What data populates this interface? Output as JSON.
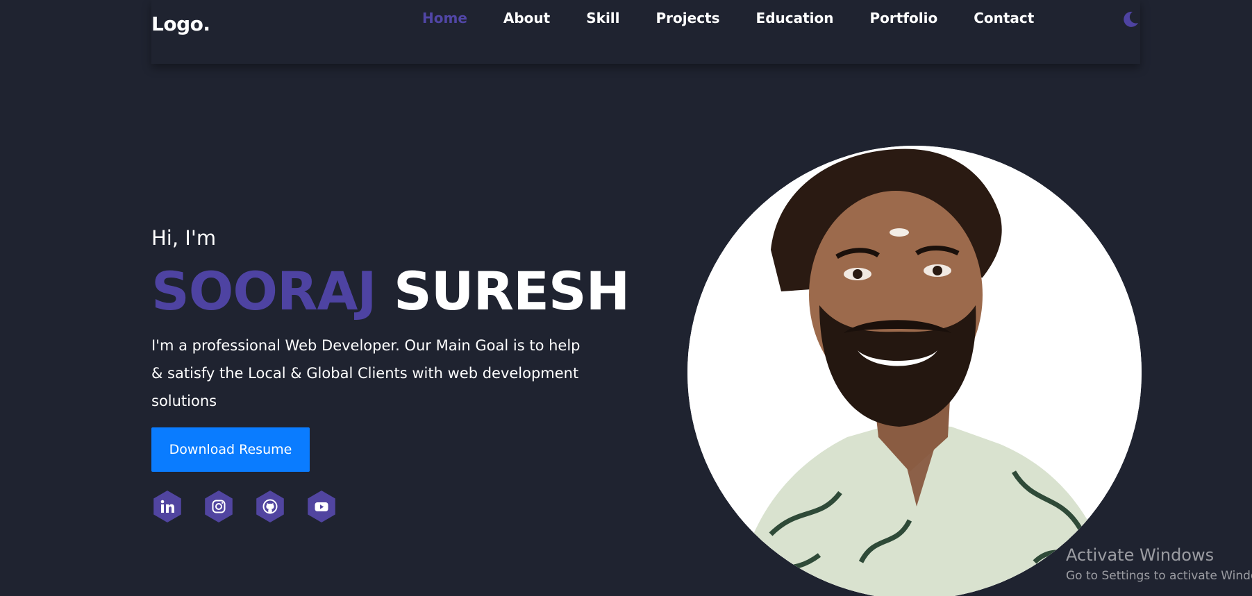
{
  "header": {
    "logo": "Logo.",
    "nav": [
      {
        "label": "Home",
        "active": true
      },
      {
        "label": "About",
        "active": false
      },
      {
        "label": "Skill",
        "active": false
      },
      {
        "label": "Projects",
        "active": false
      },
      {
        "label": "Education",
        "active": false
      },
      {
        "label": "Portfolio",
        "active": false
      },
      {
        "label": "Contact",
        "active": false
      }
    ],
    "theme_icon": "moon-icon"
  },
  "hero": {
    "greeting": "Hi, I'm",
    "first_name": "SOORAJ",
    "last_name": "SURESH",
    "description": "I'm a professional Web Developer. Our Main Goal is to help & satisfy the Local & Global Clients with web development solutions",
    "resume_label": "Download Resume",
    "socials": [
      {
        "icon": "linkedin-icon"
      },
      {
        "icon": "instagram-icon"
      },
      {
        "icon": "github-icon"
      },
      {
        "icon": "youtube-icon"
      }
    ],
    "portrait_icon": "profile-photo"
  },
  "watermark": {
    "title": "Activate Windows",
    "subtitle": "Go to Settings to activate Windows."
  },
  "colors": {
    "background": "#1f2330",
    "accent": "#4e43a2",
    "button": "#0a7cff",
    "text": "#ffffff"
  }
}
